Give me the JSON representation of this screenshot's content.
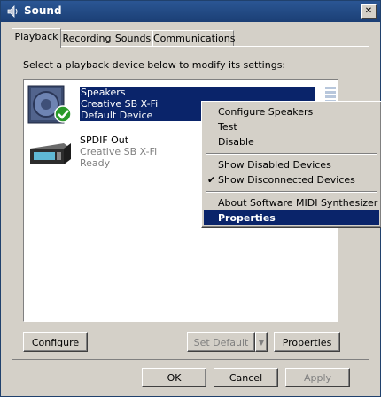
{
  "window": {
    "title": "Sound"
  },
  "tabs": [
    {
      "label": "Playback"
    },
    {
      "label": "Recording"
    },
    {
      "label": "Sounds"
    },
    {
      "label": "Communications"
    }
  ],
  "instruction": "Select a playback device below to modify its settings:",
  "devices": [
    {
      "name": "Speakers",
      "card": "Creative SB X-Fi",
      "status": "Default Device",
      "icon": "speaker-icon",
      "selected": true
    },
    {
      "name": "SPDIF Out",
      "card": "Creative SB X-Fi",
      "status": "Ready",
      "icon": "spdif-device-icon",
      "selected": false
    }
  ],
  "context_menu": {
    "items": [
      {
        "label": "Configure Speakers"
      },
      {
        "label": "Test"
      },
      {
        "label": "Disable"
      },
      {
        "label": "Show Disabled Devices"
      },
      {
        "label": "Show Disconnected Devices",
        "checked": true
      },
      {
        "label": "About Software MIDI Synthesizer"
      },
      {
        "label": "Properties",
        "highlighted": true
      }
    ]
  },
  "panel_buttons": {
    "configure": "Configure",
    "set_default": "Set Default",
    "properties": "Properties"
  },
  "dialog_buttons": {
    "ok": "OK",
    "cancel": "Cancel",
    "apply": "Apply"
  },
  "colors": {
    "selection": "#0a246a",
    "titlebar": "#1b3f75",
    "face": "#d4d0c8"
  }
}
